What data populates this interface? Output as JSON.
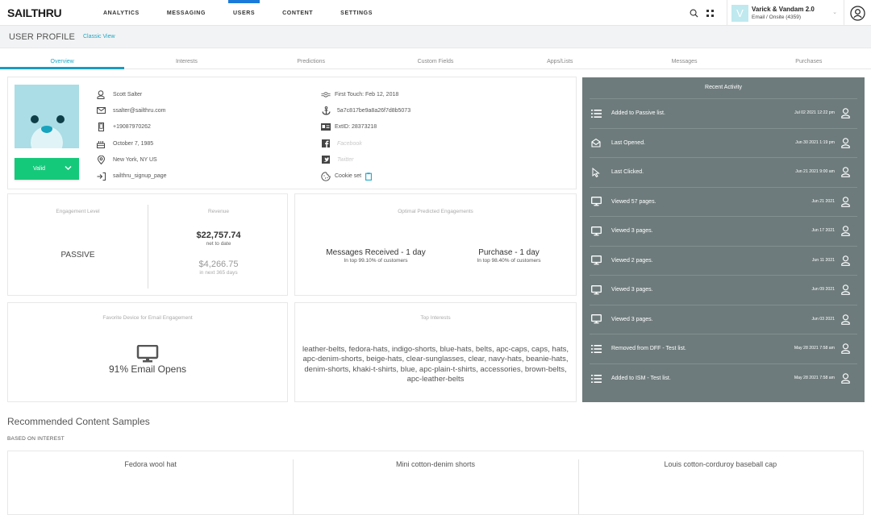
{
  "app": {
    "logo": "SAILTHRU",
    "nav": [
      "ANALYTICS",
      "MESSAGING",
      "USERS",
      "CONTENT",
      "SETTINGS"
    ],
    "active_nav": "USERS",
    "account": {
      "initial": "V",
      "name": "Varick & Vandam 2.0",
      "subtitle": "Email / Onsite (4359)"
    }
  },
  "subheader": {
    "title": "USER PROFILE",
    "classic_link": "Classic View"
  },
  "tabs": [
    "Overview",
    "Interests",
    "Predictions",
    "Custom Fields",
    "Apps/Lists",
    "Messages",
    "Purchases"
  ],
  "active_tab": "Overview",
  "profile": {
    "status": "Valid",
    "name": "Scott Salter",
    "email": "ssalter@sailthru.com",
    "phone": "+19087970262",
    "birthday": "October 7, 1985",
    "location": "New York, NY US",
    "signup_source": "sailthru_signup_page",
    "first_touch": "First Touch: Feb 12, 2018",
    "sid": "5a7c817be9a8a26f7d8b5073",
    "ext_id": "ExtID: 28373218",
    "facebook": "Facebook",
    "twitter": "Twitter",
    "cookie": "Cookie set"
  },
  "engagement": {
    "title": "Engagement Level",
    "level": "PASSIVE"
  },
  "revenue": {
    "title": "Revenue",
    "net": "$22,757.74",
    "net_label": "net to date",
    "predicted": "$4,266.75",
    "predicted_label": "in next 365 days"
  },
  "predictions": {
    "title": "Optimal Predicted Engagements",
    "items": [
      {
        "main": "Messages Received - 1 day",
        "sub": "In top 99.10% of customers"
      },
      {
        "main": "Purchase - 1 day",
        "sub": "In top 98.40% of customers"
      }
    ]
  },
  "device": {
    "title": "Favorite Device for Email Engagement",
    "icon": "desktop-icon",
    "value": "91% Email Opens"
  },
  "top_interests": {
    "title": "Top Interests",
    "text": "leather-belts, fedora-hats, indigo-shorts, blue-hats, belts, apc-caps, caps, hats, apc-denim-shorts, beige-hats, clear-sunglasses, clear, navy-hats, beanie-hats, denim-shorts, khaki-t-shirts, blue, apc-plain-t-shirts, accessories, brown-belts, apc-leather-belts"
  },
  "recent_activity": {
    "title": "Recent Activity",
    "items": [
      {
        "icon": "list-icon",
        "text": "Added to Passive list.",
        "date": "Jul 02 2021 12:22 pm"
      },
      {
        "icon": "envelope-open-icon",
        "text": "Last Opened.",
        "date": "Jun 30 2021 1:19 pm"
      },
      {
        "icon": "cursor-icon",
        "text": "Last Clicked.",
        "date": "Jun 21 2021 9:00 am"
      },
      {
        "icon": "desktop-icon",
        "text": "Viewed 57 pages.",
        "date": "Jun 21 2021"
      },
      {
        "icon": "desktop-icon",
        "text": "Viewed 3 pages.",
        "date": "Jun 17 2021"
      },
      {
        "icon": "desktop-icon",
        "text": "Viewed 2 pages.",
        "date": "Jun 11 2021"
      },
      {
        "icon": "desktop-icon",
        "text": "Viewed 3 pages.",
        "date": "Jun 09 2021"
      },
      {
        "icon": "desktop-icon",
        "text": "Viewed 3 pages.",
        "date": "Jun 03 2021"
      },
      {
        "icon": "list-icon",
        "text": "Removed from DFF - Test list.",
        "date": "May 28 2021 7:58 am"
      },
      {
        "icon": "list-icon",
        "text": "Added to ISM - Test list.",
        "date": "May 28 2021 7:58 am"
      }
    ]
  },
  "recommended": {
    "title": "Recommended Content Samples",
    "subtitle": "BASED ON INTEREST",
    "items": [
      "Fedora wool hat",
      "Mini cotton-denim shorts",
      "Louis cotton-corduroy baseball cap"
    ]
  },
  "colors": {
    "accent": "#1ea8c7",
    "nav_active": "#1a7ad9",
    "valid_green": "#15c97b",
    "activity_bg": "#6e7b7c"
  }
}
